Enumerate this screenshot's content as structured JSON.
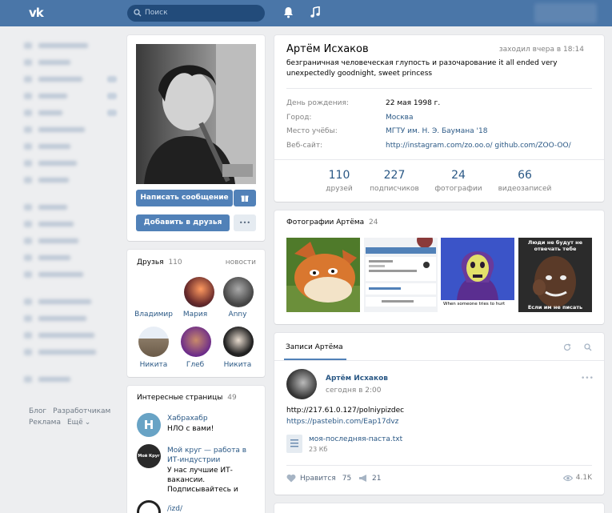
{
  "header": {
    "search_placeholder": "Поиск",
    "logo_text": "vk"
  },
  "footer": {
    "links": [
      "Блог",
      "Разработчикам",
      "Реклама",
      "Ещё"
    ]
  },
  "profile": {
    "name": "Артём Исхаков",
    "last_seen": "заходил вчера в 18:14",
    "status": "безграничная человеческая глупость и разочарование it all ended very unexpectedly goodnight, sweet princess",
    "info": [
      {
        "label": "День рождения:",
        "value": "22 мая 1998 г."
      },
      {
        "label": "Город:",
        "value": "Москва"
      },
      {
        "label": "Место учёбы:",
        "value": "МГТУ им. Н. Э. Баумана '18"
      },
      {
        "label": "Веб-сайт:",
        "value": "http://instagram.com/zo.oo.o/ github.com/ZOO-OO/"
      }
    ],
    "counters": [
      {
        "num": "110",
        "label": "друзей"
      },
      {
        "num": "227",
        "label": "подписчиков"
      },
      {
        "num": "24",
        "label": "фотографии"
      },
      {
        "num": "66",
        "label": "видеозаписей"
      }
    ]
  },
  "actions": {
    "message": "Написать сообщение",
    "add_friend": "Добавить в друзья",
    "more": "•••"
  },
  "friends": {
    "title": "Друзья",
    "count": "110",
    "updates": "новости",
    "list": [
      "Владимир",
      "Мария",
      "Anny",
      "Никита",
      "Глеб",
      "Никита"
    ]
  },
  "pages": {
    "title": "Интересные страницы",
    "count": "49",
    "items": [
      {
        "name": "Хабрахабр",
        "desc": "НЛО с вами!"
      },
      {
        "name": "Мой круг — работа в ИТ-индустрии",
        "desc": "У нас лучшие ИТ-вакансии. Подписывайтесь и"
      },
      {
        "name": "/izd/",
        "desc": ""
      }
    ],
    "logo_letter": "H",
    "moikrug_logo": "Мой Круг"
  },
  "photos": {
    "title": "Фотографии Артёма",
    "count": "24",
    "meme1_caption": "When someone tries to hurt",
    "meme2_top": "Люди не будут не отвечать тебе",
    "meme2_bottom": "Если им не писать"
  },
  "wall": {
    "tab": "Записи Артёма",
    "post": {
      "author": "Артём Исхаков",
      "time": "сегодня в 2:00",
      "line1": "http://217.61.0.127/polniypizdec",
      "line2": "https://pastebin.com/Eap17dvz",
      "file_name": "моя-последняя-паста.txt",
      "file_size": "23 Кб",
      "likes_label": "Нравится",
      "likes": "75",
      "reposts": "21",
      "views": "4.1K"
    }
  },
  "colors": {
    "header": "#4a76a8",
    "accent": "#5181b8",
    "link": "#2a5885",
    "background": "#edeef0"
  }
}
